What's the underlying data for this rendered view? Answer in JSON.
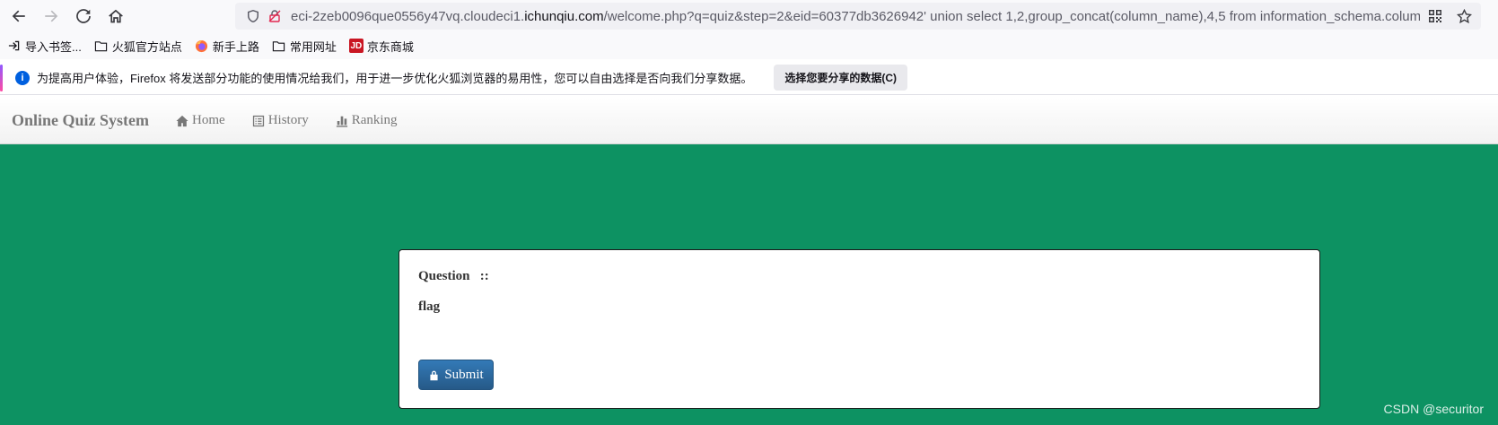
{
  "browser": {
    "url_prefix": "eci-2zeb0096que0556y47vq.cloudeci1.",
    "url_host": "ichunqiu.com",
    "url_rest": "/welcome.php?q=quiz&step=2&eid=60377db3626942' union select 1,2,group_concat(column_name),4,5 from information_schema.columns"
  },
  "bookmarks": [
    {
      "label": "导入书签...",
      "icon": "import-icon"
    },
    {
      "label": "火狐官方站点",
      "icon": "folder-icon"
    },
    {
      "label": "新手上路",
      "icon": "firefox-icon"
    },
    {
      "label": "常用网址",
      "icon": "folder-icon"
    },
    {
      "label": "京东商城",
      "icon": "jd-icon"
    }
  ],
  "jd_badge": "JD",
  "notice": {
    "text": "为提高用户体验，Firefox 将发送部分功能的使用情况给我们，用于进一步优化火狐浏览器的易用性，您可以自由选择是否向我们分享数据。",
    "button": "选择您要分享的数据(C)"
  },
  "site": {
    "brand": "Online Quiz System",
    "nav": [
      "Home",
      "History",
      "Ranking"
    ]
  },
  "quiz": {
    "question_label": "Question   ::",
    "question_text": "flag",
    "submit_label": "Submit"
  },
  "watermark": "CSDN @securitor",
  "colors": {
    "main_bg": "#0d9262",
    "submit_bg": "#337ab7"
  }
}
